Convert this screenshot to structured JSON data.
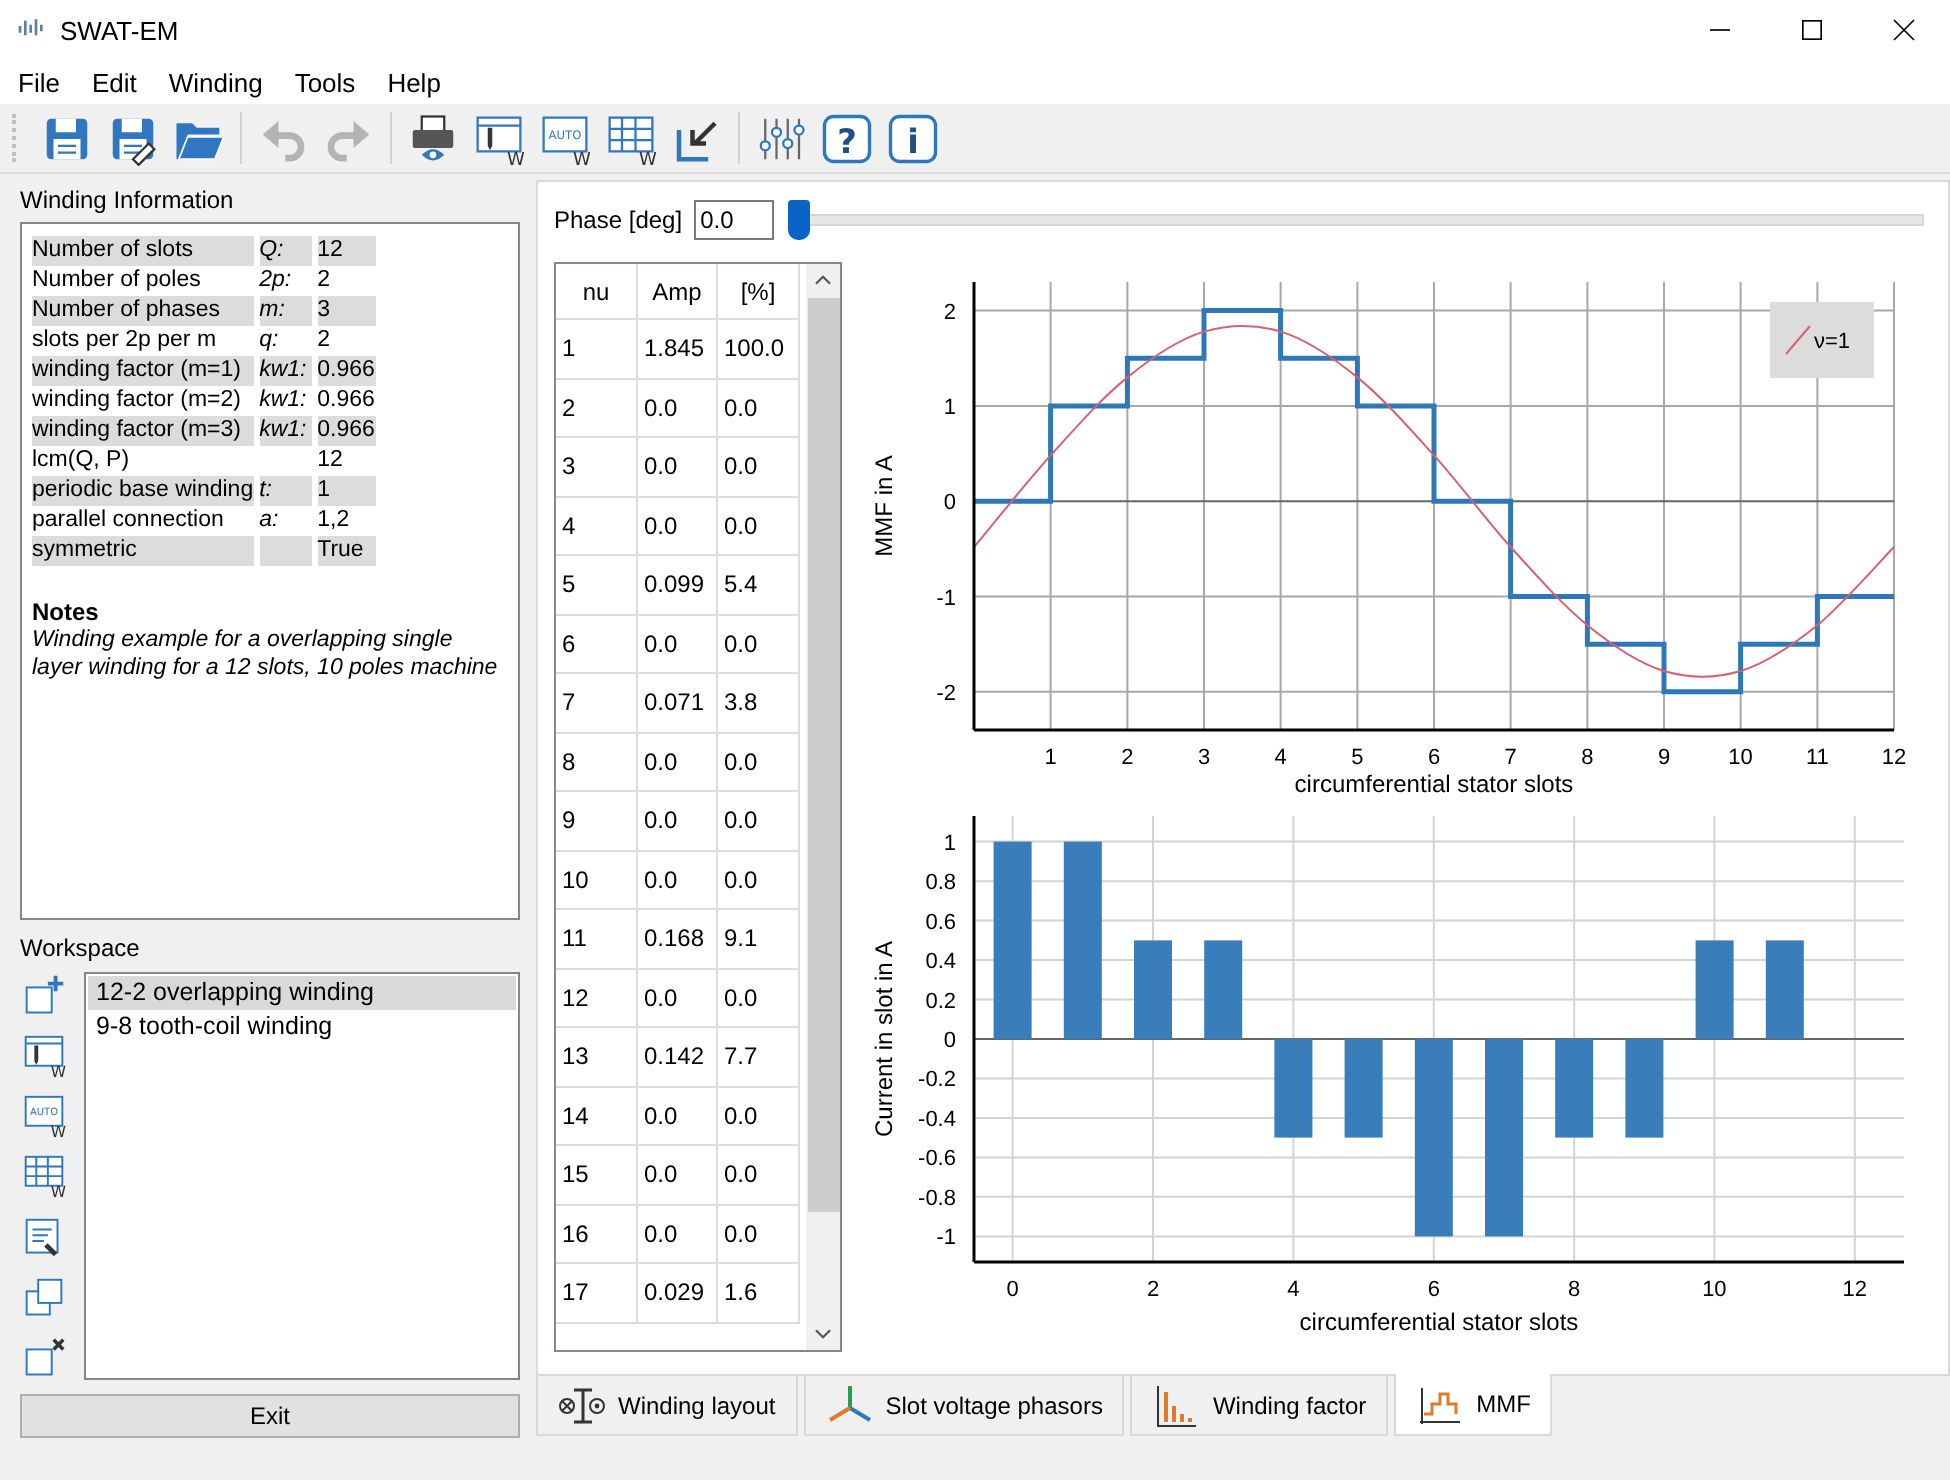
{
  "window": {
    "title": "SWAT-EM"
  },
  "menu": [
    "File",
    "Edit",
    "Winding",
    "Tools",
    "Help"
  ],
  "toolbar": [
    {
      "kind": "save",
      "disabled": false
    },
    {
      "kind": "save_as",
      "disabled": false
    },
    {
      "kind": "open",
      "disabled": false
    },
    {
      "kind": "separator"
    },
    {
      "kind": "undo",
      "disabled": true
    },
    {
      "kind": "redo",
      "disabled": true
    },
    {
      "kind": "separator"
    },
    {
      "kind": "preview",
      "disabled": false
    },
    {
      "kind": "layout",
      "sub": "W",
      "disabled": false
    },
    {
      "kind": "auto",
      "glyph": "AUTO",
      "sub": "W",
      "disabled": false
    },
    {
      "kind": "table",
      "sub": "W",
      "disabled": false
    },
    {
      "kind": "import",
      "disabled": false
    },
    {
      "kind": "separator"
    },
    {
      "kind": "settings",
      "disabled": false
    },
    {
      "kind": "help",
      "glyph": "?",
      "disabled": false
    },
    {
      "kind": "info",
      "glyph": "i",
      "disabled": false
    }
  ],
  "winding_information": {
    "title": "Winding Information",
    "rows": [
      {
        "label": "Number of slots",
        "symbol": "Q:",
        "value": "12"
      },
      {
        "label": "Number of poles",
        "symbol": "2p:",
        "value": "2"
      },
      {
        "label": "Number of phases",
        "symbol": "m:",
        "value": "3"
      },
      {
        "label": "slots per 2p per m",
        "symbol": "q:",
        "value": "2"
      },
      {
        "label": "winding factor (m=1)",
        "symbol": "kw1:",
        "value": "0.966"
      },
      {
        "label": "winding factor (m=2)",
        "symbol": "kw1:",
        "value": "0.966"
      },
      {
        "label": "winding factor (m=3)",
        "symbol": "kw1:",
        "value": "0.966"
      },
      {
        "label": "lcm(Q, P)",
        "value": "12"
      },
      {
        "label": "periodic base winding",
        "symbol": "t:",
        "value": "1"
      },
      {
        "label": "parallel connection",
        "symbol": "a:",
        "value": "1,2"
      },
      {
        "label": "symmetric",
        "value": "True"
      }
    ],
    "notes": {
      "title": "Notes",
      "text": "Winding example for a overlapping single layer winding for a 12 slots, 10 poles machine"
    }
  },
  "workspace": {
    "title": "Workspace",
    "tools": [
      {
        "kind": "add"
      },
      {
        "kind": "layout",
        "sub": "W"
      },
      {
        "kind": "auto",
        "glyph": "AUTO",
        "sub": "W"
      },
      {
        "kind": "table",
        "sub": "W"
      },
      {
        "kind": "edit"
      },
      {
        "kind": "duplicate"
      },
      {
        "kind": "delete"
      }
    ],
    "items": [
      {
        "label": "12-2 overlapping winding",
        "selected": true
      },
      {
        "label": "9-8 tooth-coil winding",
        "selected": false
      }
    ]
  },
  "exit_button": "Exit",
  "phase": {
    "label": "Phase [deg]",
    "value": "0.0",
    "level": 0
  },
  "harmonics": {
    "columns": [
      "nu",
      "Amp",
      "[%]"
    ],
    "rows": [
      [
        "1",
        "1.845",
        "100.0"
      ],
      [
        "2",
        "0.0",
        "0.0"
      ],
      [
        "3",
        "0.0",
        "0.0"
      ],
      [
        "4",
        "0.0",
        "0.0"
      ],
      [
        "5",
        "0.099",
        "5.4"
      ],
      [
        "6",
        "0.0",
        "0.0"
      ],
      [
        "7",
        "0.071",
        "3.8"
      ],
      [
        "8",
        "0.0",
        "0.0"
      ],
      [
        "9",
        "0.0",
        "0.0"
      ],
      [
        "10",
        "0.0",
        "0.0"
      ],
      [
        "11",
        "0.168",
        "9.1"
      ],
      [
        "12",
        "0.0",
        "0.0"
      ],
      [
        "13",
        "0.142",
        "7.7"
      ],
      [
        "14",
        "0.0",
        "0.0"
      ],
      [
        "15",
        "0.0",
        "0.0"
      ],
      [
        "16",
        "0.0",
        "0.0"
      ],
      [
        "17",
        "0.029",
        "1.6"
      ]
    ]
  },
  "mmf_chart": {
    "chart_data": {
      "type": "line",
      "xlabel": "circumferential stator slots",
      "ylabel": "MMF in A",
      "x": [
        0,
        1,
        1,
        2,
        2,
        3,
        3,
        4,
        4,
        5,
        5,
        6,
        6,
        7,
        7,
        8,
        8,
        9,
        9,
        10,
        10,
        11,
        11,
        12
      ],
      "series": [
        {
          "color": "#2e78b7",
          "values": [
            0,
            0,
            1,
            1,
            1.5,
            1.5,
            2,
            2,
            1.5,
            1.5,
            1,
            1,
            0,
            0,
            -1,
            -1,
            -1.5,
            -1.5,
            -2,
            -2,
            -1.5,
            -1.5,
            -1,
            -1
          ]
        },
        {
          "name": "ν=1",
          "color": "#d9606e",
          "values": [
            -0.48,
            0.48,
            0.48,
            1.3,
            1.3,
            1.78,
            1.78,
            1.78,
            1.78,
            1.3,
            1.3,
            0.48,
            0.48,
            -0.48,
            -0.48,
            -1.3,
            -1.3,
            -1.78,
            -1.78,
            -1.78,
            -1.78,
            -1.3,
            -1.3,
            -0.48
          ]
        }
      ],
      "xlim": [
        0,
        12
      ],
      "ylim": [
        -2.4,
        2.3
      ],
      "xticks": [
        1,
        2,
        3,
        4,
        5,
        6,
        7,
        8,
        9,
        10,
        11,
        12
      ],
      "yticks": [
        -2,
        -1,
        0,
        1,
        2
      ],
      "grid": true
    }
  },
  "current_chart": {
    "chart_data": {
      "type": "bar",
      "xlabel": "circumferential stator slots",
      "ylabel": "Current in slot in A",
      "x": [
        0,
        1,
        2,
        3,
        4,
        5,
        6,
        7,
        8,
        9,
        10,
        11
      ],
      "series": [
        {
          "color": "#3a7dbb",
          "values": [
            1,
            1,
            0.5,
            0.5,
            -0.5,
            -0.5,
            -1,
            -1,
            -0.5,
            -0.5,
            0.5,
            0.5
          ]
        }
      ],
      "xlim": [
        -0.55,
        12.7
      ],
      "ylim": [
        -1.13,
        1.13
      ],
      "xticks": [
        0,
        2,
        4,
        6,
        8,
        10,
        12
      ],
      "yticks": [
        -1,
        -0.8,
        -0.6,
        -0.4,
        -0.2,
        0,
        0.2,
        0.4,
        0.6,
        0.8,
        1
      ],
      "grid": true
    }
  },
  "tabs": [
    {
      "label": "Winding layout",
      "kind": "layout",
      "selected": false
    },
    {
      "label": "Slot voltage phasors",
      "kind": "phasors",
      "selected": false
    },
    {
      "label": "Winding factor",
      "kind": "bars",
      "selected": false
    },
    {
      "label": "MMF",
      "kind": "mmf",
      "selected": true
    }
  ]
}
